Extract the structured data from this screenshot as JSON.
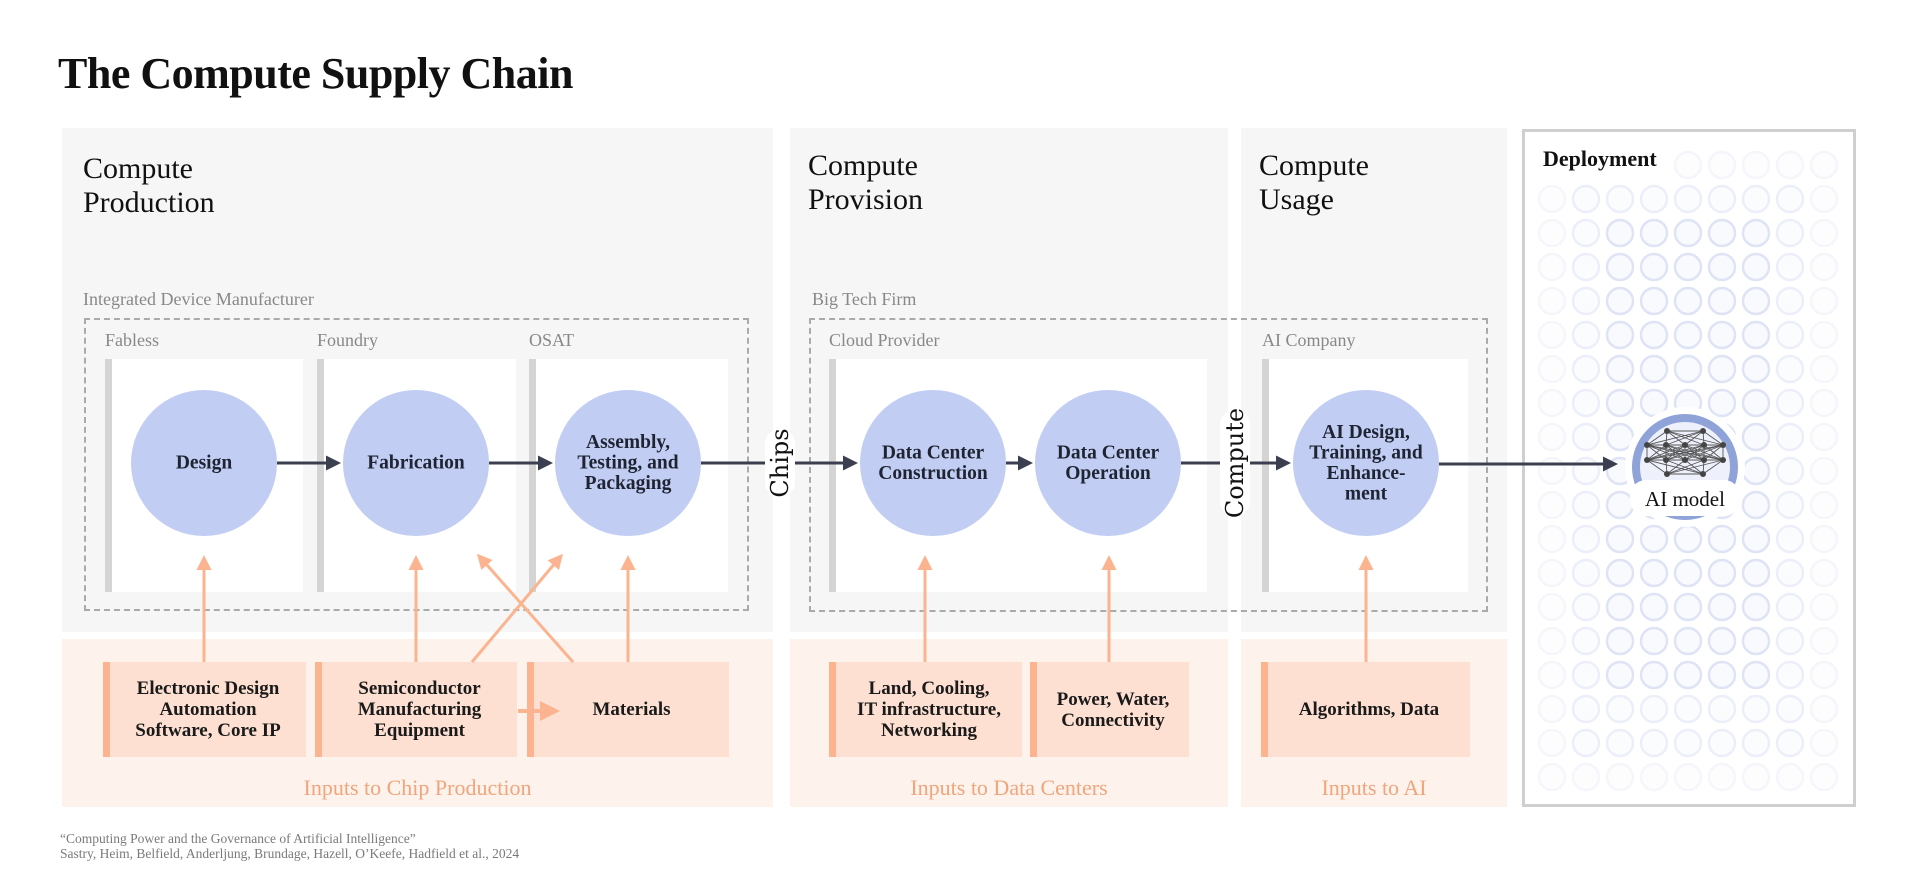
{
  "title": "The Compute Supply Chain",
  "colors": {
    "node_fill": "#c1cdf2",
    "flow_arrow": "#3b3f4f",
    "input_arrow": "#fbb48f",
    "model_ring": "#8fa3d8",
    "panel_bg": "#f6f6f6",
    "inputs_bg": "#fef2ec",
    "input_box_bg": "#fde0d2"
  },
  "stages": [
    {
      "id": "production",
      "title": "Compute\nProduction"
    },
    {
      "id": "provision",
      "title": "Compute\nProvision"
    },
    {
      "id": "usage",
      "title": "Compute\nUsage"
    }
  ],
  "groups": {
    "idm": "Integrated Device Manufacturer",
    "big_tech": "Big Tech Firm"
  },
  "actors": [
    {
      "label": "Fabless"
    },
    {
      "label": "Foundry"
    },
    {
      "label": "OSAT"
    },
    {
      "label": "Cloud Provider"
    },
    {
      "label": "AI Company"
    }
  ],
  "nodes": [
    {
      "id": "design",
      "lines": [
        "Design"
      ]
    },
    {
      "id": "fabrication",
      "lines": [
        "Fabrication"
      ]
    },
    {
      "id": "atp",
      "lines": [
        "Assembly,",
        "Testing, and",
        "Packaging"
      ]
    },
    {
      "id": "dc-construction",
      "lines": [
        "Data Center",
        "Construction"
      ]
    },
    {
      "id": "dc-operation",
      "lines": [
        "Data Center",
        "Operation"
      ]
    },
    {
      "id": "ai-design",
      "lines": [
        "AI Design,",
        "Training, and",
        "Enhance-",
        "ment"
      ]
    }
  ],
  "flow_labels": {
    "chips": "Chips",
    "compute": "Compute"
  },
  "inputs": [
    {
      "label": "Electronic Design\nAutomation\nSoftware, Core IP"
    },
    {
      "label": "Semiconductor\nManufacturing\nEquipment"
    },
    {
      "label": "Materials"
    },
    {
      "label": "Land, Cooling,\nIT infrastructure,\nNetworking"
    },
    {
      "label": "Power, Water,\nConnectivity"
    },
    {
      "label": "Algorithms, Data"
    }
  ],
  "input_groups": {
    "chip": "Inputs to Chip Production",
    "datacenter": "Inputs to Data Centers",
    "ai": "Inputs to AI"
  },
  "deployment": {
    "title": "Deployment",
    "model_label": "AI model",
    "model_icon": "neural-network-icon"
  },
  "footer": {
    "citation": "“Computing Power and the Governance of Artificial Intelligence”",
    "authors": "Sastry, Heim, Belfield, Anderljung, Brundage, Hazell, O’Keefe, Hadfield et al., 2024"
  }
}
